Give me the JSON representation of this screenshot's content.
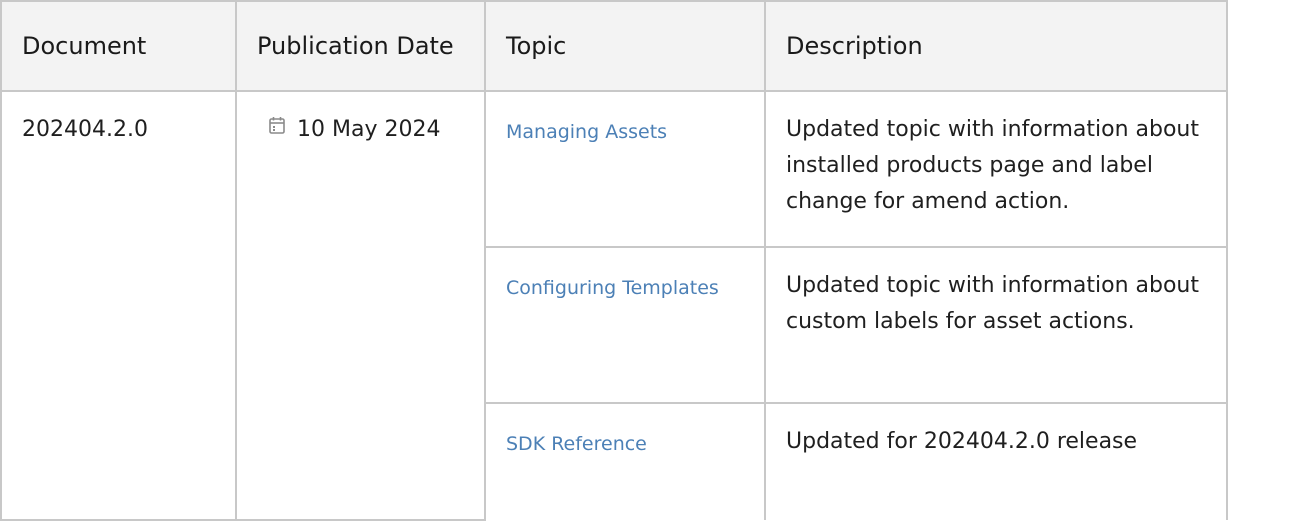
{
  "table": {
    "headers": [
      "Document",
      "Publication Date",
      "Topic",
      "Description"
    ],
    "document": "202404.2.0",
    "publication_date": "10 May 2024",
    "date_icon": "calendar-icon",
    "rows": [
      {
        "topic": "Managing Assets",
        "description": "Updated topic with information about installed products page and label change for amend action."
      },
      {
        "topic": "Configuring Templates",
        "description": "Updated topic with information about custom labels for asset actions."
      },
      {
        "topic": "SDK Reference",
        "description": "Updated for 202404.2.0 release"
      }
    ]
  }
}
